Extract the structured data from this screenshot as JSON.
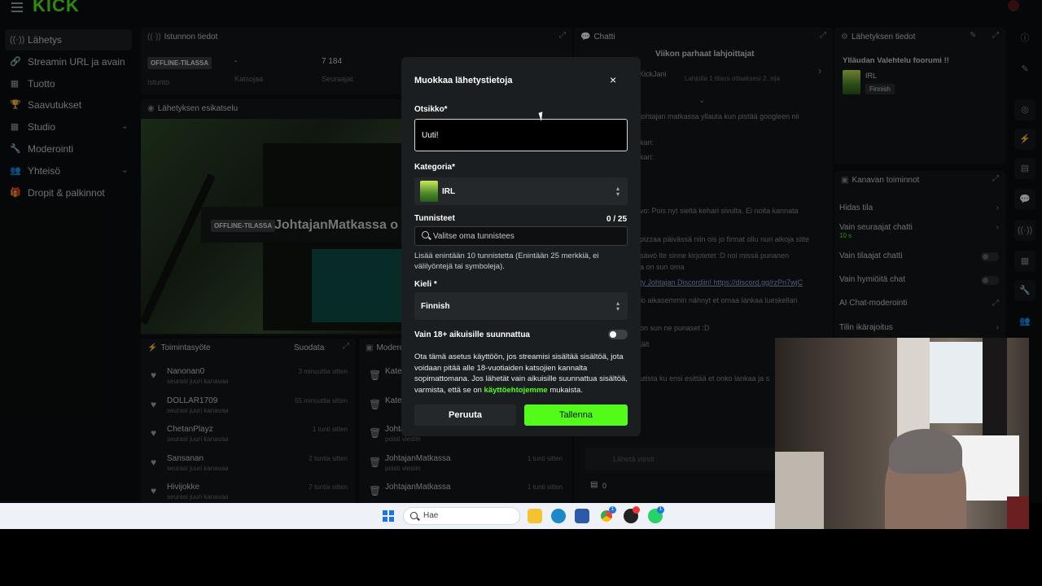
{
  "app": {
    "logo": "KICK",
    "sidebar": [
      {
        "label": "Lähetys",
        "icon": "broadcast-icon",
        "glyph": "((·))",
        "active": true
      },
      {
        "label": "Streamin URL ja avain",
        "icon": "link-icon",
        "glyph": "🔗"
      },
      {
        "label": "Tuotto",
        "icon": "chart-icon",
        "glyph": "▦"
      },
      {
        "label": "Saavutukset",
        "icon": "trophy-icon",
        "glyph": "🏆"
      },
      {
        "label": "Studio",
        "icon": "studio-icon",
        "glyph": "▦",
        "chevron": "⌄"
      },
      {
        "label": "Moderointi",
        "icon": "wrench-icon",
        "glyph": "🔧"
      },
      {
        "label": "Yhteisö",
        "icon": "community-icon",
        "glyph": "👥",
        "chevron": "⌄"
      },
      {
        "label": "Dropit & palkinnot",
        "icon": "gift-icon",
        "glyph": "🎁"
      }
    ],
    "session": {
      "title": "Istunnon tiedot",
      "status": "OFFLINE-TILASSA",
      "status_sub": "Istunto",
      "viewers_value": "-",
      "viewers_label": "Katsojaa",
      "followers_value": "7 184",
      "followers_label": "Seuraajat"
    },
    "preview": {
      "title": "Lähetyksen esikatselu",
      "badge": "OFFLINE-TILASSA",
      "channel": "JohtajanMatkassa o"
    },
    "activity": {
      "title": "Toimintasyöte",
      "filter": "Suodata",
      "items": [
        {
          "name": "Nanonan0",
          "sub": "seurasi juuri kanavaa",
          "time": "3 minuuttia sitten"
        },
        {
          "name": "DOLLAR1709",
          "sub": "seurasi juuri kanavaa",
          "time": "55 minuuttia sitten"
        },
        {
          "name": "ChetanPlayz",
          "sub": "seurasi juuri kanavaa",
          "time": "1 tunti sitten"
        },
        {
          "name": "Sansanan",
          "sub": "seurasi juuri kanavaa",
          "time": "2 tuntia sitten"
        },
        {
          "name": "Hivijokke",
          "sub": "seurasi juuri kanavaa",
          "time": "7 tuntia sitten"
        }
      ]
    },
    "mod": {
      "title": "Modero",
      "items": [
        {
          "name": "Kate",
          "sub": ""
        },
        {
          "name": "Kate",
          "sub": ""
        },
        {
          "name": "Johta",
          "sub": "poisti viestin",
          "time": "1 tunti sitten"
        },
        {
          "name": "JohtajanMatkassa",
          "sub": "poisti viestin",
          "time": "1 tunti sitten"
        },
        {
          "name": "JohtajanMatkassa",
          "sub": "",
          "time": "1 tunti sitten"
        }
      ]
    },
    "chat": {
      "title": "Chatti",
      "top_gifters": "Viikon parhaat lahjoittajat",
      "gifter_name": "KickJani",
      "gifter_note": "Lahjoita 1 tilaus ottaaksesi 2. sija",
      "lines": [
        "johtajan matkassa yllauta kun pistää googleen nii",
        "kari:",
        "kari:",
        "",
        "vo: Pois nyt sieltä kehari sivulta. Ei noita kannata",
        "",
        "pizzaa päivässä niin ois jo firmat ollu nuri aikoja sitte",
        "säwö lte sinne kirjotetet :D nol missä punanen",
        "a on sun oma",
        "ty Johtajan Discordiin! https://discord.gg/rzPn7wjC",
        "lo aikasemmin nähnyt et omaa lankaa lueskellan",
        "",
        "on sun ne punaset :D",
        "jält",
        "",
        "utista ku ensi esittää et onko lankaa ja s"
      ],
      "input_placeholder": "Lähetä viesti",
      "count": "0"
    },
    "stream_info": {
      "title": "Lähetyksen tiedot",
      "stream_title": "Ylläudan Valehtelu foorumi !!",
      "category": "IRL",
      "language": "Finnish"
    },
    "channel_actions": {
      "title": "Kanavan toiminnot",
      "items": [
        {
          "label": "Hidas tila",
          "type": "chevron"
        },
        {
          "label": "Vain seuraajat chatti",
          "sub": "10 s",
          "type": "chevron"
        },
        {
          "label": "Vain tilaajat chatti",
          "type": "toggle"
        },
        {
          "label": "Vain hymiöitä chat",
          "type": "toggle"
        },
        {
          "label": "AI Chat-moderointi",
          "type": "external"
        },
        {
          "label": "Tilin ikärajoitus",
          "type": "chevron"
        }
      ]
    }
  },
  "modal": {
    "title": "Muokkaa lähetystietoja",
    "close_icon": "×",
    "title_label": "Otsikko*",
    "title_value": "Uuti!",
    "category_label": "Kategoria*",
    "category_value": "IRL",
    "tags_label": "Tunnisteet",
    "tags_count": "0 / 25",
    "tags_placeholder": "Valitse oma tunnistees",
    "tags_help": "Lisää enintään 10 tunnistetta (Enintään 25 merkkiä, ei välilyöntejä tai symboleja).",
    "language_label": "Kieli *",
    "language_value": "Finnish",
    "adult_label": "Vain 18+ aikuisille suunnattua",
    "adult_enabled": false,
    "warning_text": "Ota tämä asetus käyttöön, jos streamisi sisältää sisältöä, jota voidaan pitää alle 18-vuotiaiden katsojien kannalta sopimattomana. Jos lähetät vain aikuisille suunnattua sisältöä, varmista, että se on ",
    "tos_link": "käyttöehtojemme",
    "warning_tail": " mukaista.",
    "cancel_label": "Peruuta",
    "save_label": "Tallenna",
    "accent_color": "#53fc18"
  },
  "taskbar": {
    "search_placeholder": "Hae"
  }
}
